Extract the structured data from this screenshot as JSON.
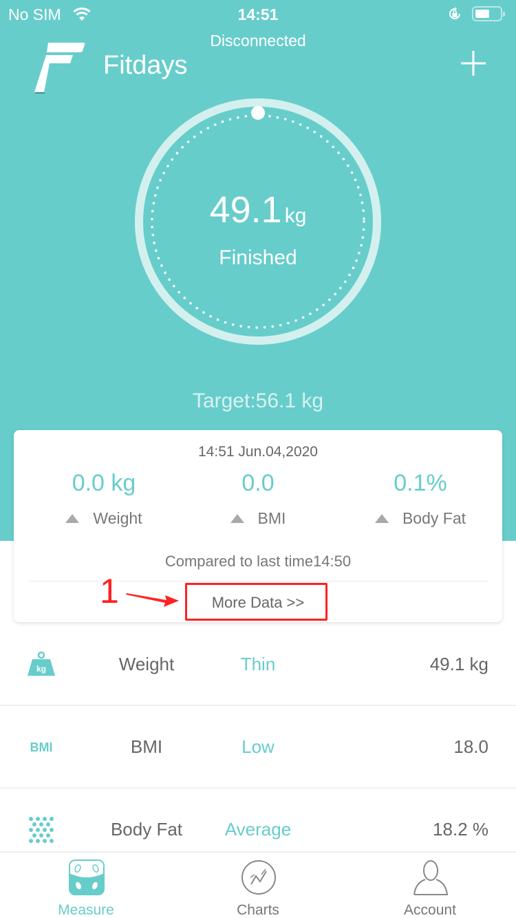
{
  "colors": {
    "brand": "#67cdcb",
    "annotation": "#ff2222",
    "text_gray": "#666666"
  },
  "status_bar": {
    "carrier": "No SIM",
    "time": "14:51",
    "icons": [
      "wifi-icon",
      "rotation-lock-icon",
      "battery-icon"
    ]
  },
  "header": {
    "connection_status": "Disconnected",
    "app_title": "Fitdays",
    "add_icon": "plus-icon"
  },
  "gauge": {
    "value": "49.1",
    "unit": "kg",
    "status": "Finished"
  },
  "target": "Target:56.1 kg",
  "summary_card": {
    "date": "14:51 Jun.04,2020",
    "metrics": [
      {
        "value": "0.0 kg",
        "label": "Weight",
        "trend": "up"
      },
      {
        "value": "0.0",
        "label": "BMI",
        "trend": "up"
      },
      {
        "value": "0.1%",
        "label": "Body Fat",
        "trend": "up"
      }
    ],
    "compare_text": "Compared to last time14:50",
    "more_data_label": "More Data >>"
  },
  "annotation": {
    "number": "1"
  },
  "metric_list": [
    {
      "icon": "weight-kg-icon",
      "name": "Weight",
      "level": "Thin",
      "value": "49.1 kg"
    },
    {
      "icon": "bmi-icon",
      "icon_text": "BMI",
      "name": "BMI",
      "level": "Low",
      "value": "18.0"
    },
    {
      "icon": "body-fat-dots-icon",
      "name": "Body Fat",
      "level": "Average",
      "value": "18.2 %"
    }
  ],
  "tab_bar": {
    "tabs": [
      {
        "label": "Measure",
        "icon": "scale-icon",
        "active": true
      },
      {
        "label": "Charts",
        "icon": "chart-icon",
        "active": false
      },
      {
        "label": "Account",
        "icon": "person-icon",
        "active": false
      }
    ]
  }
}
